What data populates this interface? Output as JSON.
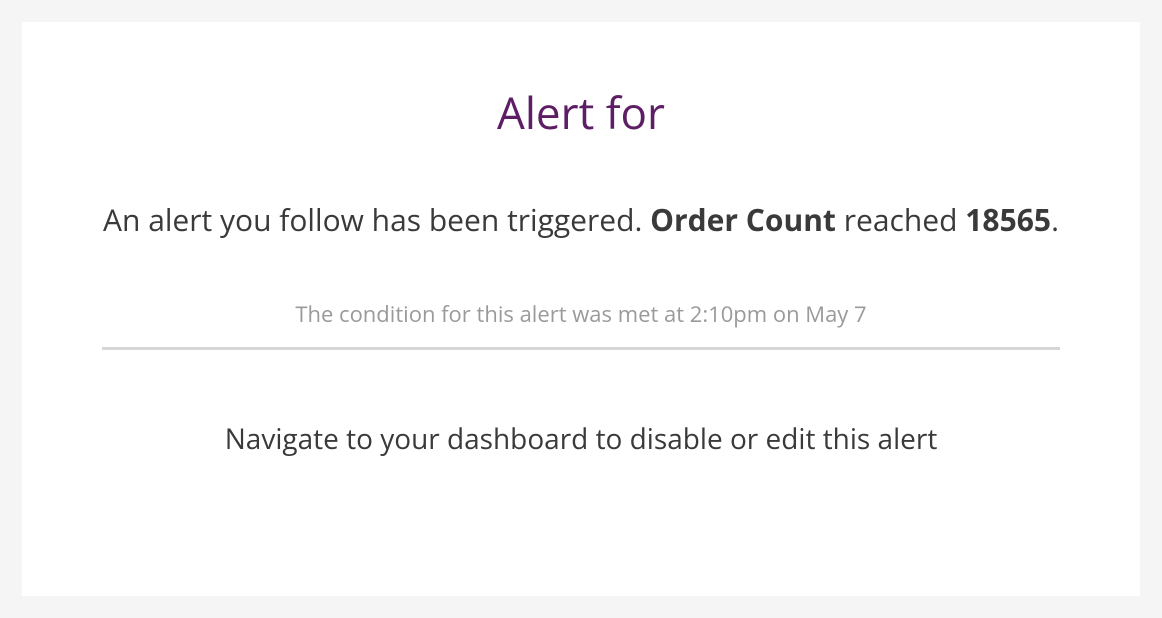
{
  "title": "Alert for",
  "message": {
    "prefix": "An alert you follow has been triggered. ",
    "metric_name": "Order Count",
    "mid": " reached ",
    "value": "18565",
    "suffix": "."
  },
  "condition_text": "The condition for this alert was met at 2:10pm on May 7",
  "instruction": "Navigate to your dashboard to disable or edit this alert"
}
